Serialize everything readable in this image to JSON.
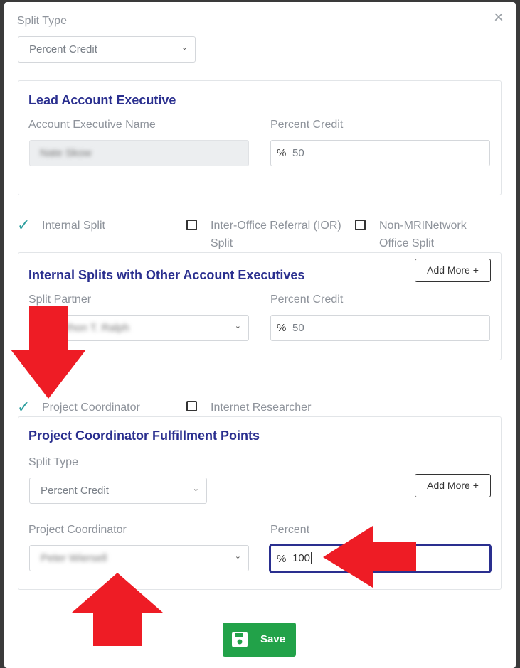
{
  "close_icon": "×",
  "split_type": {
    "label": "Split Type",
    "value": "Percent Credit"
  },
  "lead_ae": {
    "title": "Lead Account Executive",
    "name_label": "Account Executive Name",
    "name_value": "Nate Skow",
    "percent_label": "Percent Credit",
    "percent_symbol": "%",
    "percent_value": "50"
  },
  "split_options": [
    {
      "label": "Internal Split",
      "checked": true
    },
    {
      "label": "Inter-Office Referral (IOR) Split",
      "checked": false
    },
    {
      "label": "Non-MRINetwork Office Split",
      "checked": false
    }
  ],
  "internal_splits": {
    "title": "Internal Splits with Other Account Executives",
    "add_more": "Add More +",
    "partner_label": "Split Partner",
    "partner_value": "Rhon T. Ralph",
    "percent_label": "Percent Credit",
    "percent_symbol": "%",
    "percent_value": "50"
  },
  "role_options": [
    {
      "label": "Project Coordinator",
      "checked": true
    },
    {
      "label": "Internet Researcher",
      "checked": false
    }
  ],
  "pc_fulfillment": {
    "title": "Project Coordinator Fulfillment Points",
    "split_type_label": "Split Type",
    "split_type_value": "Percent Credit",
    "add_more": "Add More +",
    "coordinator_label": "Project Coordinator",
    "coordinator_value": "Peter Wiersell",
    "percent_label": "Percent",
    "percent_symbol": "%",
    "percent_value": "100"
  },
  "save_label": "Save",
  "colors": {
    "accent": "#2a2f8f",
    "save": "#22a249",
    "check": "#2a9d9d",
    "arrow": "#ee1c25"
  }
}
